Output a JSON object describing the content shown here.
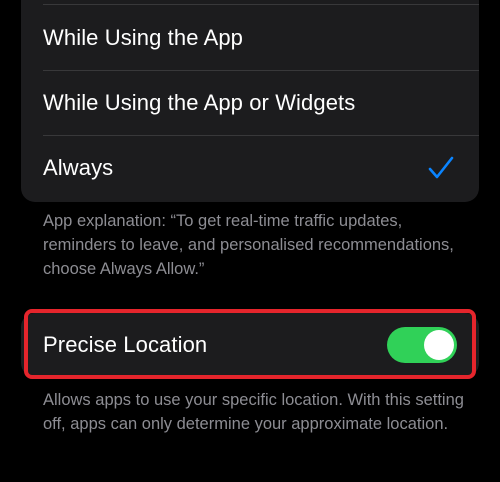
{
  "location_access": {
    "options": [
      {
        "label": "While Using the App",
        "selected": false
      },
      {
        "label": "While Using the App or Widgets",
        "selected": false
      },
      {
        "label": "Always",
        "selected": true
      }
    ],
    "explanation": "App explanation: “To get real-time traffic updates, reminders to leave, and personalised recommendations, choose Always Allow.”"
  },
  "precise_location": {
    "label": "Precise Location",
    "enabled": true,
    "description": "Allows apps to use your specific location. With this setting off, apps can only determine your approximate location."
  },
  "colors": {
    "background": "#000000",
    "group_background": "#1c1c1e",
    "accent_blue": "#0a84ff",
    "toggle_on": "#30d158",
    "highlight_red": "#e5252c",
    "secondary_text": "#8d8d93"
  },
  "icons": {
    "selected_marker": "checkmark-icon"
  }
}
